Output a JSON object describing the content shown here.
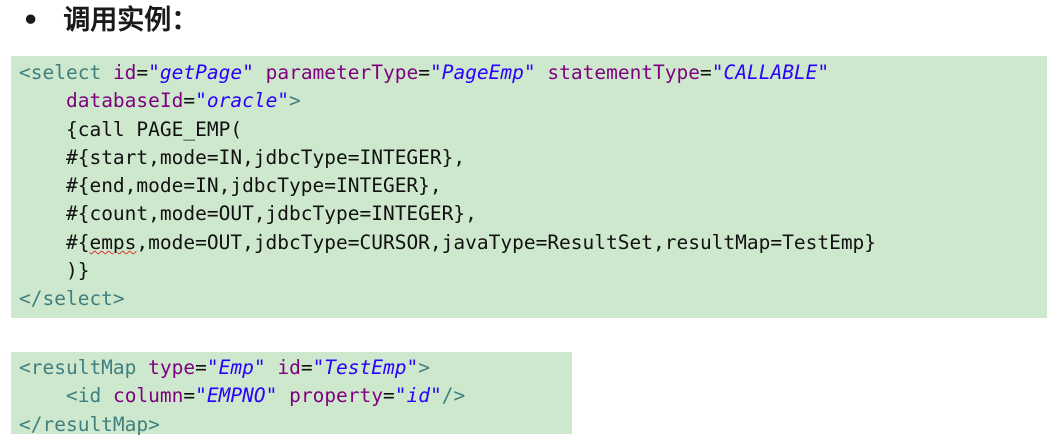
{
  "heading": {
    "bullet": "•",
    "title": "调用实例："
  },
  "select_block": {
    "open_tag": "<select",
    "attr_id": "id",
    "val_id": "\"getPage\"",
    "attr_param": "parameterType",
    "val_param": "\"PageEmp\"",
    "attr_stmt": "statementType",
    "val_stmt": "\"CALLABLE\"",
    "attr_db": "databaseId",
    "val_db": "\"oracle\"",
    "open_close": ">",
    "body_lines": [
      "{call PAGE_EMP(",
      "#{start,mode=IN,jdbcType=INTEGER},",
      "#{end,mode=IN,jdbcType=INTEGER},",
      "#{count,mode=OUT,jdbcType=INTEGER},",
      "#{",
      "emps",
      ",mode=OUT,jdbcType=CURSOR,javaType=ResultSet,resultMap=TestEmp}",
      ")}"
    ],
    "close_tag": "</select>"
  },
  "resultmap_block": {
    "open_tag": "<resultMap",
    "attr_type": "type",
    "val_type": "\"Emp\"",
    "attr_id": "id",
    "val_id": "\"TestEmp\"",
    "open_close": ">",
    "id_open": "<id",
    "attr_column": "column",
    "val_column": "\"EMPNO\"",
    "attr_property": "property",
    "val_property": "\"id\"",
    "id_close": "/>",
    "close_tag": "</resultMap>"
  },
  "colors": {
    "code_background": "#cde8cd",
    "tag": "#3f7f7f",
    "attribute": "#7f007f",
    "value": "#2a00ff"
  }
}
